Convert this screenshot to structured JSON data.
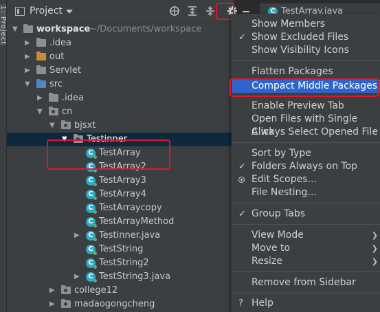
{
  "left_stripe": {
    "tab_label": "1: Project"
  },
  "toolbar": {
    "title": "Project",
    "icons": [
      "crosshair-icon",
      "expand-all-icon",
      "collapse-all-icon",
      "gear-icon",
      "minimize-icon"
    ]
  },
  "editor_tab": {
    "label": "TestArray.java"
  },
  "tree": {
    "root": {
      "name": "workspace",
      "hint": "~/Documents/workspace"
    },
    "items": [
      {
        "name": ".idea"
      },
      {
        "name": "out"
      },
      {
        "name": "Servlet"
      },
      {
        "name": "src"
      },
      {
        "name": ".idea"
      },
      {
        "name": "cn"
      },
      {
        "name": "bjsxt"
      },
      {
        "name": "Testinner"
      },
      {
        "name": "TestArray"
      },
      {
        "name": "TestArray2"
      },
      {
        "name": "TestArray3"
      },
      {
        "name": "TestArray4"
      },
      {
        "name": "TestArraycopy"
      },
      {
        "name": "TestArrayMethod"
      },
      {
        "name": "Testinner.java"
      },
      {
        "name": "TestString"
      },
      {
        "name": "TestString2"
      },
      {
        "name": "TestString3.java"
      },
      {
        "name": "college12"
      },
      {
        "name": "madaogongcheng"
      }
    ]
  },
  "menu": {
    "items": [
      {
        "label": "Show Members"
      },
      {
        "label": "Show Excluded Files",
        "checked": true
      },
      {
        "label": "Show Visibility Icons"
      },
      {
        "label": "Flatten Packages"
      },
      {
        "label": "Compact Middle Packages",
        "active": true
      },
      {
        "label": "Enable Preview Tab"
      },
      {
        "label": "Open Files with Single Click"
      },
      {
        "label": "Always Select Opened File"
      },
      {
        "label": "Sort by Type"
      },
      {
        "label": "Folders Always on Top",
        "checked": true
      },
      {
        "label": "Edit Scopes...",
        "radio": true
      },
      {
        "label": "File Nesting..."
      },
      {
        "label": "Group Tabs",
        "checked": true
      },
      {
        "label": "View Mode",
        "submenu": true
      },
      {
        "label": "Move to",
        "submenu": true
      },
      {
        "label": "Resize",
        "submenu": true
      },
      {
        "label": "Remove from Sidebar"
      },
      {
        "label": "Help",
        "prefix": "?"
      }
    ]
  },
  "colors": {
    "highlight_red": "#e0162b",
    "menu_active": "#2f65ca",
    "selected_row": "#0d293e",
    "class_icon": "#2fa8c4"
  }
}
